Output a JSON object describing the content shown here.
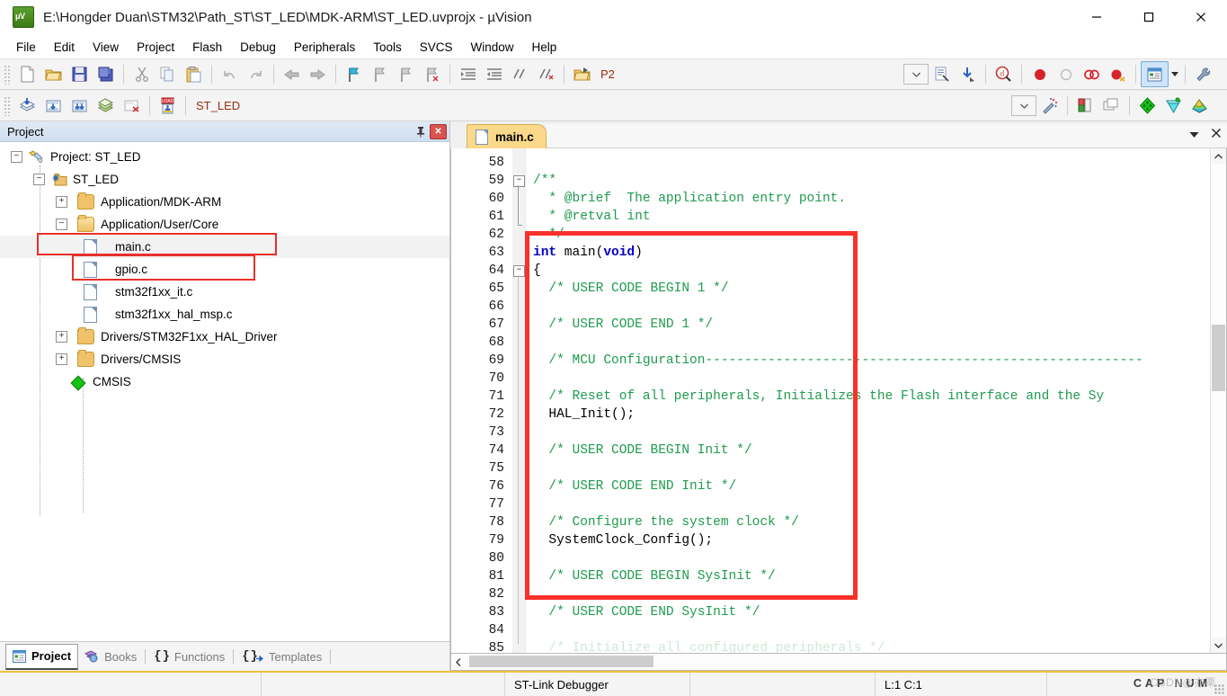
{
  "window": {
    "title": "E:\\Hongder Duan\\STM32\\Path_ST\\ST_LED\\MDK-ARM\\ST_LED.uvprojx - µVision",
    "app_icon": "uvision-logo-icon",
    "minimize": "—",
    "maximize": "□",
    "close": "✕"
  },
  "menu": {
    "items": [
      "File",
      "Edit",
      "View",
      "Project",
      "Flash",
      "Debug",
      "Peripherals",
      "Tools",
      "SVCS",
      "Window",
      "Help"
    ]
  },
  "toolbar1": {
    "buttons": [
      {
        "name": "new-file-icon",
        "glyph": "🗋"
      },
      {
        "name": "open-file-icon",
        "glyph": "📂"
      },
      {
        "name": "save-icon",
        "glyph": "💾"
      },
      {
        "name": "save-all-icon",
        "glyph": "🖫"
      },
      {
        "name": "cut-icon",
        "glyph": "✂"
      },
      {
        "name": "copy-icon",
        "glyph": "🗐"
      },
      {
        "name": "paste-icon",
        "glyph": "📋"
      },
      {
        "name": "undo-icon",
        "glyph": "↶"
      },
      {
        "name": "redo-icon",
        "glyph": "↷"
      },
      {
        "name": "navigate-backward-icon",
        "glyph": "←"
      },
      {
        "name": "navigate-forward-icon",
        "glyph": "→"
      },
      {
        "name": "insert-bookmark-icon",
        "glyph": "⚑"
      },
      {
        "name": "prev-bookmark-icon",
        "glyph": "⚑"
      },
      {
        "name": "next-bookmark-icon",
        "glyph": "⚑"
      },
      {
        "name": "clear-bookmarks-icon",
        "glyph": "⚑"
      },
      {
        "name": "indent-icon",
        "glyph": "⇥"
      },
      {
        "name": "outdent-icon",
        "glyph": "⇤"
      },
      {
        "name": "comment-icon",
        "glyph": "∕"
      },
      {
        "name": "uncomment-icon",
        "glyph": "∕"
      },
      {
        "name": "open-folder-icon",
        "glyph": "📁"
      }
    ],
    "target_label": "P2",
    "right_buttons": [
      {
        "name": "target-options-icon",
        "glyph": "🗎"
      },
      {
        "name": "download-icon",
        "glyph": "⬇"
      },
      {
        "name": "start-debug-icon",
        "glyph": "ⓘ"
      },
      {
        "name": "insert-breakpoint-icon",
        "glyph": "●"
      },
      {
        "name": "remove-breakpoint-icon",
        "glyph": "○"
      },
      {
        "name": "disable-breakpoint-icon",
        "glyph": "◌"
      },
      {
        "name": "kill-breakpoints-icon",
        "glyph": "●"
      },
      {
        "name": "project-window-icon",
        "glyph": "▤"
      },
      {
        "name": "configure-icon",
        "glyph": "🔧"
      }
    ]
  },
  "toolbar2": {
    "buttons": [
      {
        "name": "translate-icon",
        "glyph": "◆"
      },
      {
        "name": "build-icon",
        "glyph": "▦"
      },
      {
        "name": "rebuild-icon",
        "glyph": "▦"
      },
      {
        "name": "batch-build-icon",
        "glyph": "▤"
      },
      {
        "name": "stop-build-icon",
        "glyph": "▧"
      },
      {
        "name": "download-flash-icon",
        "glyph": "LOAD"
      }
    ],
    "target_value": "ST_LED",
    "dropdown_glyph": "⌄",
    "right_buttons": [
      {
        "name": "target-options-icon",
        "glyph": "⚒"
      },
      {
        "name": "manage-run-time-env-icon",
        "glyph": "▣"
      },
      {
        "name": "multi-project-icon",
        "glyph": "❐"
      },
      {
        "name": "manage-components-icon",
        "glyph": "◆"
      },
      {
        "name": "pack-installer-icon",
        "glyph": "◇"
      },
      {
        "name": "select-software-packs-icon",
        "glyph": "❖"
      }
    ]
  },
  "project_panel": {
    "title": "Project",
    "pin_icon": "pin-icon",
    "close_icon": "close-icon",
    "tree": [
      {
        "label": "Project: ST_LED",
        "depth": 0,
        "toggle": "-",
        "icon": "project-icon",
        "selected": false,
        "highlighted": false
      },
      {
        "label": "ST_LED",
        "depth": 1,
        "toggle": "-",
        "icon": "target-icon",
        "selected": false,
        "highlighted": false
      },
      {
        "label": "Application/MDK-ARM",
        "depth": 2,
        "toggle": "+",
        "icon": "folder-icon",
        "selected": false,
        "highlighted": false
      },
      {
        "label": "Application/User/Core",
        "depth": 2,
        "toggle": "-",
        "icon": "folder-open-icon",
        "selected": false,
        "highlighted": true
      },
      {
        "label": "main.c",
        "depth": 3,
        "toggle": "",
        "icon": "c-file-icon",
        "selected": true,
        "highlighted": true
      },
      {
        "label": "gpio.c",
        "depth": 3,
        "toggle": "",
        "icon": "c-file-icon",
        "selected": false,
        "highlighted": false
      },
      {
        "label": "stm32f1xx_it.c",
        "depth": 3,
        "toggle": "",
        "icon": "c-file-icon",
        "selected": false,
        "highlighted": false
      },
      {
        "label": "stm32f1xx_hal_msp.c",
        "depth": 3,
        "toggle": "",
        "icon": "c-file-icon",
        "selected": false,
        "highlighted": false
      },
      {
        "label": "Drivers/STM32F1xx_HAL_Driver",
        "depth": 2,
        "toggle": "+",
        "icon": "folder-icon",
        "selected": false,
        "highlighted": false
      },
      {
        "label": "Drivers/CMSIS",
        "depth": 2,
        "toggle": "+",
        "icon": "folder-icon",
        "selected": false,
        "highlighted": false
      },
      {
        "label": "CMSIS",
        "depth": 2,
        "toggle": "",
        "icon": "cmsis-diamond-icon",
        "selected": false,
        "highlighted": false
      }
    ]
  },
  "view_tabs": [
    {
      "label": "Project",
      "icon": "project-window-icon",
      "active": true
    },
    {
      "label": "Books",
      "icon": "books-icon",
      "active": false
    },
    {
      "label": "Functions",
      "icon": "braces-icon",
      "active": false
    },
    {
      "label": "Templates",
      "icon": "templates-icon",
      "active": false
    }
  ],
  "editor": {
    "tab": {
      "label": "main.c",
      "icon": "c-file-icon"
    },
    "tab_actions": {
      "dropdown": "▼",
      "close": "✕"
    },
    "first_line": 58,
    "lines": [
      {
        "n": 58,
        "fold": "",
        "tokens": [
          {
            "t": "",
            "c": "plain"
          }
        ]
      },
      {
        "n": 59,
        "fold": "-",
        "tokens": [
          {
            "t": "/**",
            "c": "cmt"
          }
        ]
      },
      {
        "n": 60,
        "fold": "|",
        "tokens": [
          {
            "t": "  * @brief  The application entry point.",
            "c": "cmt"
          }
        ]
      },
      {
        "n": 61,
        "fold": "|",
        "tokens": [
          {
            "t": "  * @retval int",
            "c": "cmt"
          }
        ]
      },
      {
        "n": 62,
        "fold": "L",
        "tokens": [
          {
            "t": "  */",
            "c": "cmt"
          }
        ]
      },
      {
        "n": 63,
        "fold": "",
        "tokens": [
          {
            "t": "int",
            "c": "kw"
          },
          {
            "t": " main(",
            "c": "plain"
          },
          {
            "t": "void",
            "c": "kw"
          },
          {
            "t": ")",
            "c": "plain"
          }
        ]
      },
      {
        "n": 64,
        "fold": "-",
        "tokens": [
          {
            "t": "{",
            "c": "plain"
          }
        ]
      },
      {
        "n": 65,
        "fold": "",
        "tokens": [
          {
            "t": "  /* USER CODE BEGIN 1 */",
            "c": "cmt"
          }
        ]
      },
      {
        "n": 66,
        "fold": "",
        "tokens": [
          {
            "t": "",
            "c": "plain"
          }
        ]
      },
      {
        "n": 67,
        "fold": "",
        "tokens": [
          {
            "t": "  /* USER CODE END 1 */",
            "c": "cmt"
          }
        ]
      },
      {
        "n": 68,
        "fold": "",
        "tokens": [
          {
            "t": "",
            "c": "plain"
          }
        ]
      },
      {
        "n": 69,
        "fold": "",
        "tokens": [
          {
            "t": "  /* MCU Configuration--------------------------------------------------------",
            "c": "cmt"
          }
        ]
      },
      {
        "n": 70,
        "fold": "",
        "tokens": [
          {
            "t": "",
            "c": "plain"
          }
        ]
      },
      {
        "n": 71,
        "fold": "",
        "tokens": [
          {
            "t": "  /* Reset of all peripherals, Initializes the Flash interface and the Sy",
            "c": "cmt"
          }
        ]
      },
      {
        "n": 72,
        "fold": "",
        "tokens": [
          {
            "t": "  HAL_Init();",
            "c": "plain"
          }
        ]
      },
      {
        "n": 73,
        "fold": "",
        "tokens": [
          {
            "t": "",
            "c": "plain"
          }
        ]
      },
      {
        "n": 74,
        "fold": "",
        "tokens": [
          {
            "t": "  /* USER CODE BEGIN Init */",
            "c": "cmt"
          }
        ]
      },
      {
        "n": 75,
        "fold": "",
        "tokens": [
          {
            "t": "",
            "c": "plain"
          }
        ]
      },
      {
        "n": 76,
        "fold": "",
        "tokens": [
          {
            "t": "  /* USER CODE END Init */",
            "c": "cmt"
          }
        ]
      },
      {
        "n": 77,
        "fold": "",
        "tokens": [
          {
            "t": "",
            "c": "plain"
          }
        ]
      },
      {
        "n": 78,
        "fold": "",
        "tokens": [
          {
            "t": "  /* Configure the system clock */",
            "c": "cmt"
          }
        ]
      },
      {
        "n": 79,
        "fold": "",
        "tokens": [
          {
            "t": "  SystemClock_Config();",
            "c": "plain"
          }
        ]
      },
      {
        "n": 80,
        "fold": "",
        "tokens": [
          {
            "t": "",
            "c": "plain"
          }
        ]
      },
      {
        "n": 81,
        "fold": "",
        "tokens": [
          {
            "t": "  /* USER CODE BEGIN SysInit */",
            "c": "cmt"
          }
        ]
      },
      {
        "n": 82,
        "fold": "",
        "tokens": [
          {
            "t": "",
            "c": "plain"
          }
        ]
      },
      {
        "n": 83,
        "fold": "",
        "tokens": [
          {
            "t": "  /* USER CODE END SysInit */",
            "c": "cmt"
          }
        ]
      },
      {
        "n": 84,
        "fold": "",
        "tokens": [
          {
            "t": "",
            "c": "plain"
          }
        ]
      },
      {
        "n": 85,
        "fold": "",
        "tokens": [
          {
            "t": "  /* Initialize all configured peripherals */",
            "c": "cmt"
          }
        ]
      }
    ]
  },
  "status_bar": {
    "debugger": "ST-Link Debugger",
    "cursor": "L:1 C:1",
    "cap_num": "CAP NUM",
    "watermark": "CSDN@亦栗"
  },
  "colors": {
    "comment_green": "#1f9b4e",
    "keyword_blue": "#0000c8",
    "highlight_red": "#e8302a",
    "tab_yellow": "#fbd98a",
    "status_accent": "#f0c040"
  }
}
